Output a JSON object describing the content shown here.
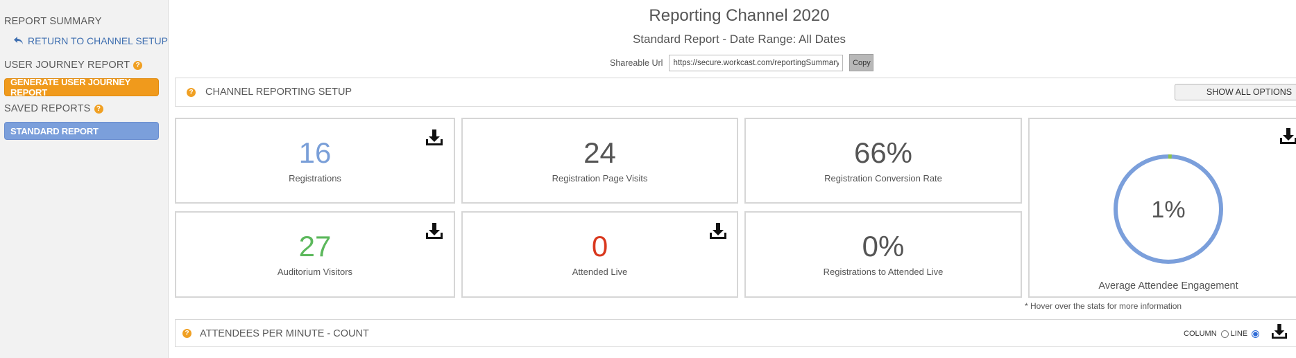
{
  "sidebar": {
    "report_summary": "REPORT SUMMARY",
    "return_link": "RETURN TO CHANNEL SETUP",
    "user_journey_heading": "USER JOURNEY REPORT",
    "generate_button": "GENERATE USER JOURNEY REPORT",
    "saved_reports_heading": "SAVED REPORTS",
    "standard_report_button": "STANDARD REPORT"
  },
  "header": {
    "title": "Reporting Channel 2020",
    "subtitle": "Standard Report - Date Range: All Dates",
    "share_label": "Shareable Url",
    "share_url": "https://secure.workcast.com/reportingSummary.",
    "copy_label": "Copy"
  },
  "setup": {
    "title": "CHANNEL REPORTING SETUP",
    "show_all_label": "SHOW ALL OPTIONS"
  },
  "stats": [
    {
      "value": "16",
      "label": "Registrations",
      "color": "#7a9fd8"
    },
    {
      "value": "24",
      "label": "Registration Page Visits",
      "color": "#555555"
    },
    {
      "value": "66%",
      "label": "Registration Conversion Rate",
      "color": "#555555"
    },
    {
      "value": "27",
      "label": "Auditorium Visitors",
      "color": "#5cb85c"
    },
    {
      "value": "0",
      "label": "Attended Live",
      "color": "#d9381e"
    },
    {
      "value": "0%",
      "label": "Registrations to Attended Live",
      "color": "#555555"
    }
  ],
  "engagement": {
    "value": "1%",
    "fraction": 0.01,
    "label": "Average Attendee Engagement",
    "ring_color": "#7b9fdb",
    "progress_color": "#8bc34a"
  },
  "hover_note": "* Hover over the stats for more information",
  "attendees": {
    "title": "ATTENDEES PER MINUTE - COUNT",
    "column_label": "COLUMN",
    "line_label": "LINE",
    "selected": "line"
  },
  "icons": {
    "help": "question-circle-icon",
    "download": "download-icon",
    "return": "reply-arrow-icon"
  }
}
